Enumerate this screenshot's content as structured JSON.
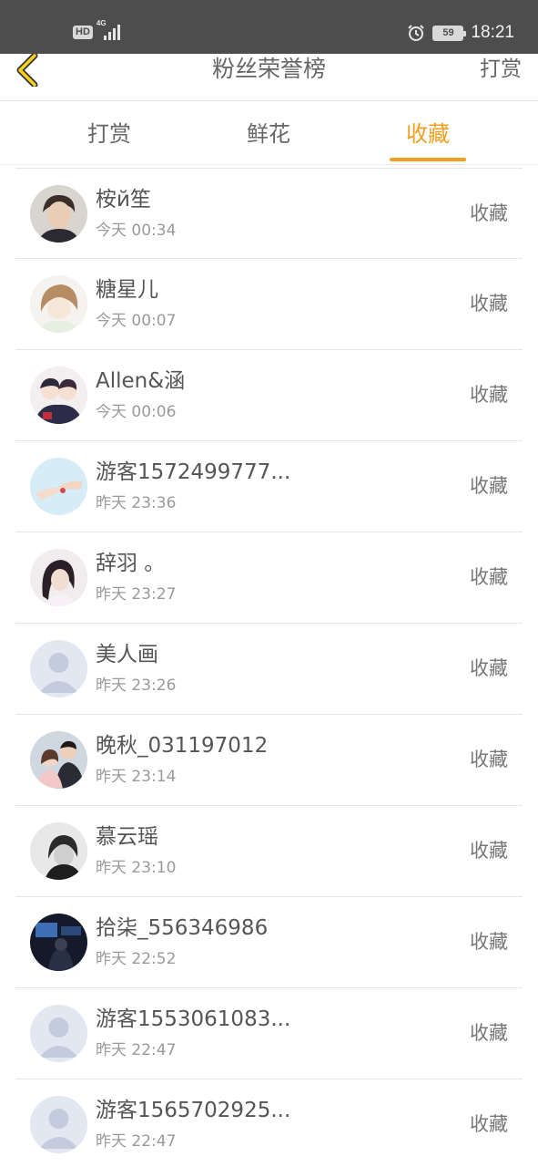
{
  "status_bar": {
    "hd": "HD",
    "network": "4G",
    "battery": "59",
    "time": "18:21"
  },
  "nav": {
    "title": "粉丝荣誉榜",
    "right_action": "打赏"
  },
  "tabs": [
    {
      "label": "打赏",
      "active": false
    },
    {
      "label": "鲜花",
      "active": false
    },
    {
      "label": "收藏",
      "active": true
    }
  ],
  "accent_color": "#f0a020",
  "fans": [
    {
      "name": "桉й笙",
      "time": "今天 00:34",
      "action": "收藏",
      "avatar": "photo-boy"
    },
    {
      "name": "糖星儿",
      "time": "今天 00:07",
      "action": "收藏",
      "avatar": "anime-girl"
    },
    {
      "name": "Allen&涵",
      "time": "今天 00:06",
      "action": "收藏",
      "avatar": "anime-couple"
    },
    {
      "name": "游客1572499777...",
      "time": "昨天 23:36",
      "action": "收藏",
      "avatar": "hands"
    },
    {
      "name": "辞羽 。",
      "time": "昨天 23:27",
      "action": "收藏",
      "avatar": "photo-girl"
    },
    {
      "name": "美人画",
      "time": "昨天 23:26",
      "action": "收藏",
      "avatar": "default"
    },
    {
      "name": "晚秋_031197012",
      "time": "昨天 23:14",
      "action": "收藏",
      "avatar": "photo-couple"
    },
    {
      "name": "慕云瑶",
      "time": "昨天 23:10",
      "action": "收藏",
      "avatar": "bw-photo"
    },
    {
      "name": "拾柒_556346986",
      "time": "昨天 22:52",
      "action": "收藏",
      "avatar": "dark-room"
    },
    {
      "name": "游客1553061083...",
      "time": "昨天 22:47",
      "action": "收藏",
      "avatar": "default"
    },
    {
      "name": "游客1565702925...",
      "time": "昨天 22:47",
      "action": "收藏",
      "avatar": "default"
    }
  ]
}
